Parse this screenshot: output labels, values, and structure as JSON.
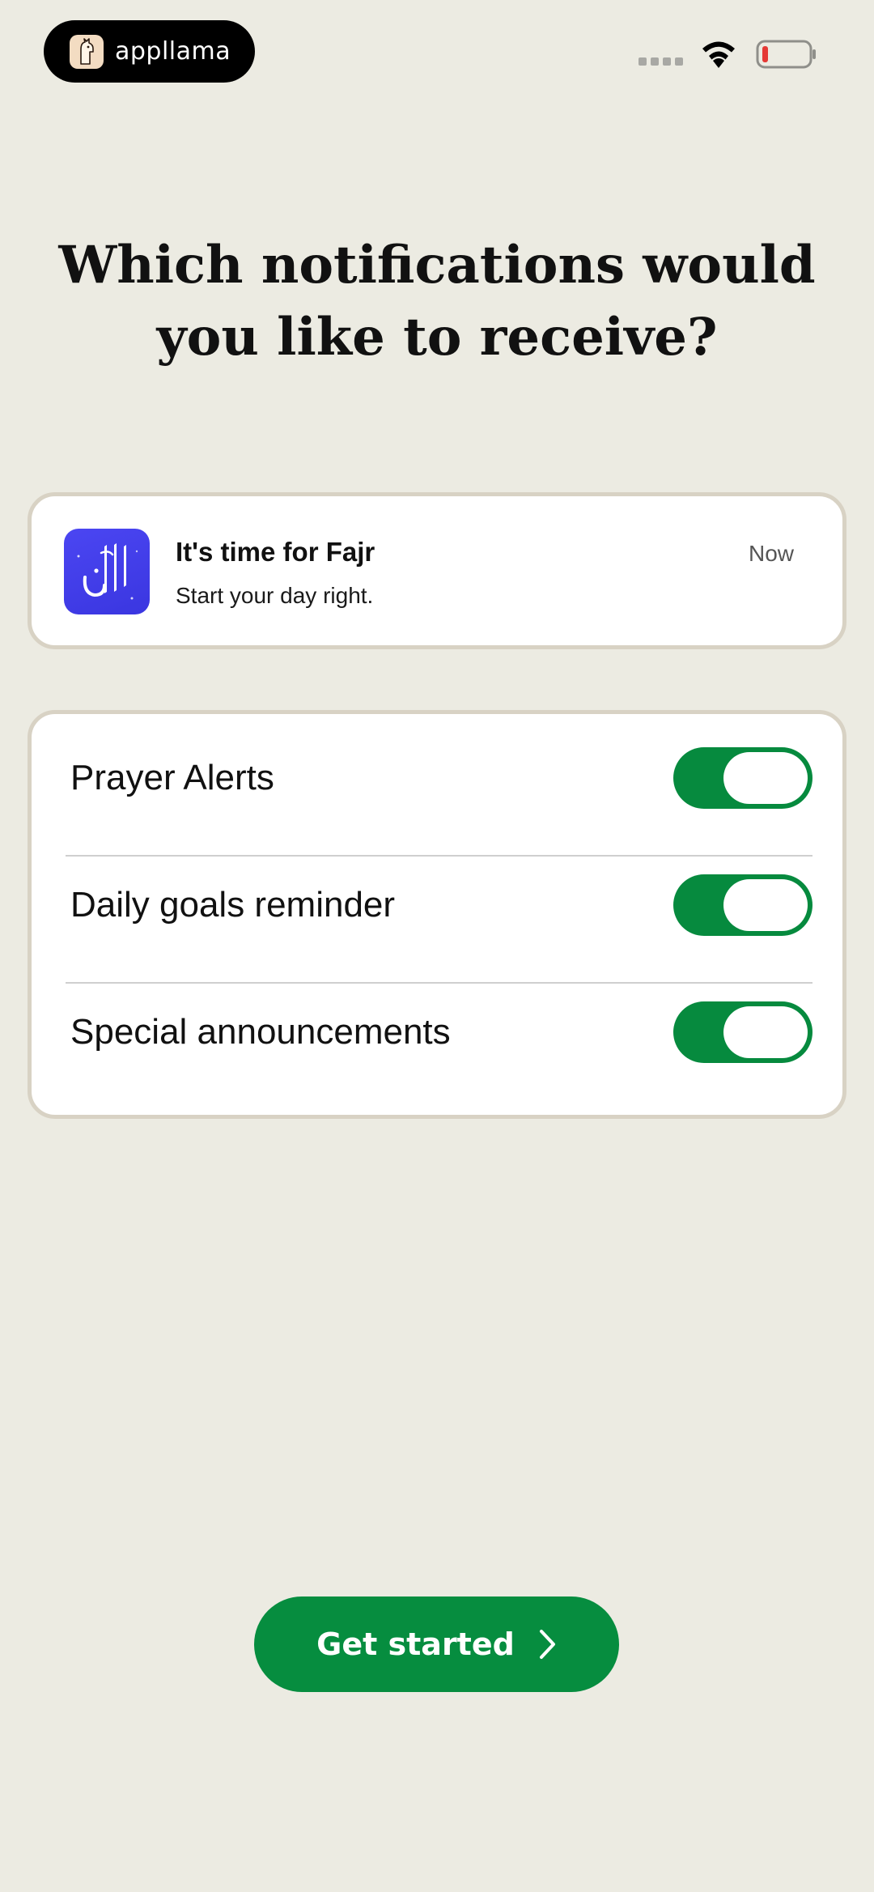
{
  "status_bar": {
    "brand_name": "appllama",
    "brand_icon": "llama-logo-icon",
    "wifi_icon": "wifi-icon",
    "battery_icon": "battery-low-icon",
    "battery_color": "#e53935"
  },
  "page": {
    "title": "Which notifications would you like to receive?"
  },
  "notification_preview": {
    "app_icon": "athan-app-icon",
    "app_icon_color": "#4641ef",
    "title": "It's time for Fajr",
    "body": "Start your day right.",
    "time": "Now"
  },
  "settings": {
    "accent_color": "#068a3e",
    "items": [
      {
        "label": "Prayer Alerts",
        "enabled": true
      },
      {
        "label": "Daily goals reminder",
        "enabled": true
      },
      {
        "label": "Special announcements",
        "enabled": true
      }
    ]
  },
  "cta": {
    "label": "Get started",
    "icon": "chevron-right-icon",
    "color": "#068d3f"
  }
}
